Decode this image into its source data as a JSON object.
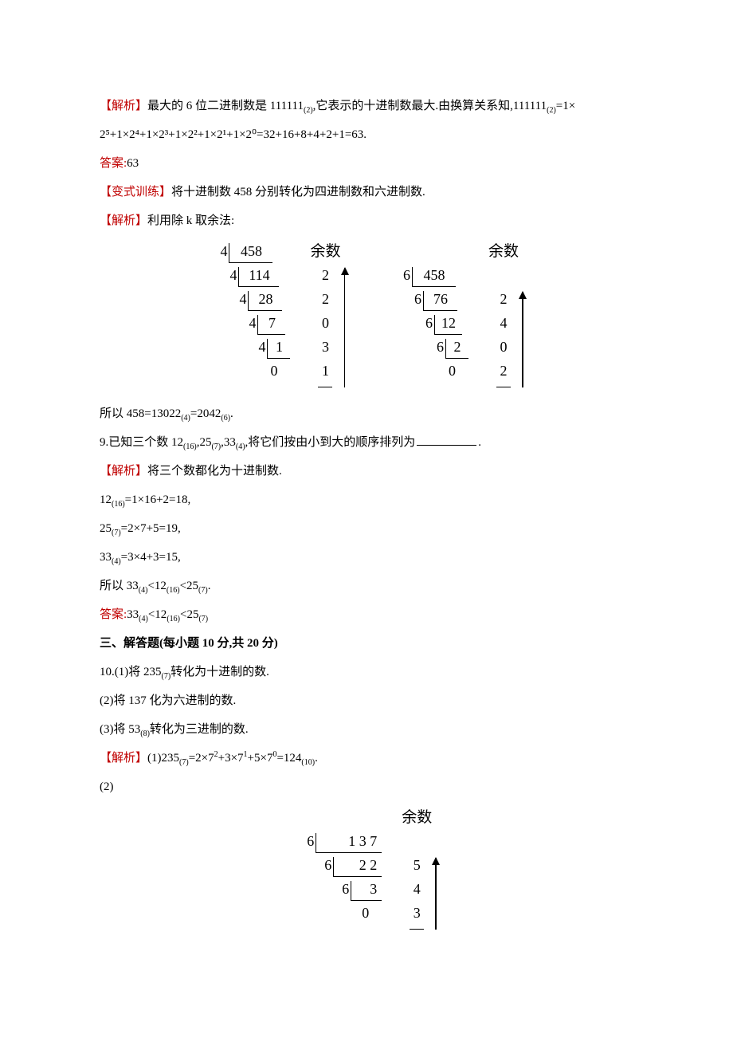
{
  "p1": {
    "a": "【解析】",
    "b": "最大的 6 位二进制数是 111111",
    "sub1": "(2)",
    "c": ",它表示的十进制数最大.由换算关系知,111111",
    "sub2": "(2)",
    "d": "=1×"
  },
  "p1b": "2⁵+1×2⁴+1×2³+1×2²+1×2¹+1×2⁰=32+16+8+4+2+1=63.",
  "ans1": {
    "label": "答案:",
    "val": "63"
  },
  "p2": {
    "a": "【变式训练】",
    "b": "将十进制数 458 分别转化为四进制数和六进制数."
  },
  "p3": {
    "a": "【解析】",
    "b": "利用除 k 取余法:"
  },
  "div4": {
    "header": "余数",
    "steps": [
      {
        "d": "4",
        "n": "458",
        "r": ""
      },
      {
        "d": "4",
        "n": "114",
        "r": "2"
      },
      {
        "d": "4",
        "n": "28",
        "r": "2"
      },
      {
        "d": "4",
        "n": "7",
        "r": "0"
      },
      {
        "d": "4",
        "n": "1",
        "r": "3"
      },
      {
        "d": "",
        "n": "0",
        "r": "1"
      }
    ]
  },
  "div6": {
    "header": "余数",
    "steps": [
      {
        "d": "6",
        "n": "458",
        "r": ""
      },
      {
        "d": "6",
        "n": "76",
        "r": "2"
      },
      {
        "d": "6",
        "n": "12",
        "r": "4"
      },
      {
        "d": "6",
        "n": "2",
        "r": "0"
      },
      {
        "d": "",
        "n": "0",
        "r": "2"
      }
    ]
  },
  "p4": {
    "a": "所以 458=13022",
    "sub1": "(4)",
    "b": "=2042",
    "sub2": "(6)",
    "c": "."
  },
  "p5": {
    "a": "9.已知三个数 12",
    "sub1": "(16)",
    "b": ",25",
    "sub2": "(7)",
    "c": ",33",
    "sub3": "(4)",
    "d": ",将它们按由小到大的顺序排列为",
    "e": "."
  },
  "p6": {
    "a": "【解析】",
    "b": "将三个数都化为十进制数."
  },
  "p7": {
    "a": "12",
    "sub1": "(16)",
    "b": "=1×16+2=18,"
  },
  "p8": {
    "a": "25",
    "sub1": "(7)",
    "b": "=2×7+5=19,"
  },
  "p9": {
    "a": "33",
    "sub1": "(4)",
    "b": "=3×4+3=15,"
  },
  "p10": {
    "a": "所以 33",
    "sub1": "(4)",
    "b": "<12",
    "sub2": "(16)",
    "c": "<25",
    "sub3": "(7)",
    "d": "."
  },
  "ans2": {
    "label": "答案:",
    "a": "33",
    "sub1": "(4)",
    "b": "<12",
    "sub2": "(16)",
    "c": "<25",
    "sub3": "(7)"
  },
  "h3": "三、解答题(每小题 10 分,共 20 分)",
  "q10a": {
    "a": "10.(1)将 235",
    "sub1": "(7)",
    "b": "转化为十进制的数."
  },
  "q10b": "(2)将 137 化为六进制的数.",
  "q10c": {
    "a": "(3)将 53",
    "sub1": "(8)",
    "b": "转化为三进制的数."
  },
  "sol10": {
    "a": "【解析】",
    "b": "(1)235",
    "sub1": "(7)",
    "c": "=2×7",
    "sup1": "2",
    "d": "+3×7",
    "sup2": "1",
    "e": "+5×7",
    "sup3": "0",
    "f": "=124",
    "sub2": "(10)",
    "g": "."
  },
  "part2": "(2)",
  "div6b": {
    "header": "余数",
    "steps": [
      {
        "d": "6",
        "n": "1 3 7",
        "r": ""
      },
      {
        "d": "6",
        "n": "2 2",
        "r": "5"
      },
      {
        "d": "6",
        "n": "3",
        "r": "4"
      },
      {
        "d": "",
        "n": "0",
        "r": "3"
      }
    ]
  }
}
